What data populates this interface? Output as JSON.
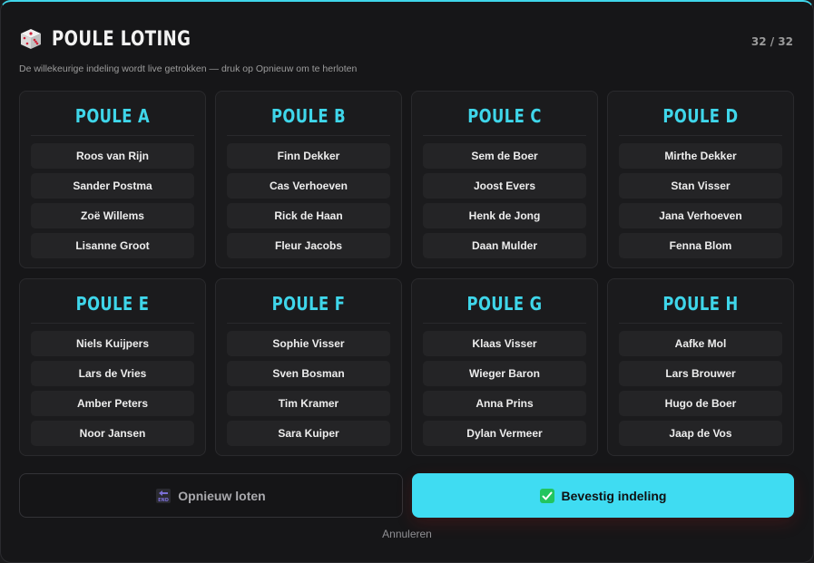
{
  "header": {
    "title": "POULE LOTING",
    "counter": "32 / 32",
    "subtitle": "De willekeurige indeling wordt live getrokken — druk op Opnieuw om te herloten",
    "icon": "dice-icon"
  },
  "poules": [
    {
      "title": "POULE A",
      "players": [
        "Roos van Rijn",
        "Sander Postma",
        "Zoë Willems",
        "Lisanne Groot"
      ]
    },
    {
      "title": "POULE B",
      "players": [
        "Finn Dekker",
        "Cas Verhoeven",
        "Rick de Haan",
        "Fleur Jacobs"
      ]
    },
    {
      "title": "POULE C",
      "players": [
        "Sem de Boer",
        "Joost Evers",
        "Henk de Jong",
        "Daan Mulder"
      ]
    },
    {
      "title": "POULE D",
      "players": [
        "Mirthe Dekker",
        "Stan Visser",
        "Jana Verhoeven",
        "Fenna Blom"
      ]
    },
    {
      "title": "POULE E",
      "players": [
        "Niels Kuijpers",
        "Lars de Vries",
        "Amber Peters",
        "Noor Jansen"
      ]
    },
    {
      "title": "POULE F",
      "players": [
        "Sophie Visser",
        "Sven Bosman",
        "Tim Kramer",
        "Sara Kuiper"
      ]
    },
    {
      "title": "POULE G",
      "players": [
        "Klaas Visser",
        "Wieger Baron",
        "Anna Prins",
        "Dylan Vermeer"
      ]
    },
    {
      "title": "POULE H",
      "players": [
        "Aafke Mol",
        "Lars Brouwer",
        "Hugo de Boer",
        "Jaap de Vos"
      ]
    }
  ],
  "actions": {
    "reroll_label": "Opnieuw loten",
    "reroll_icon": "end-arrow-icon",
    "confirm_label": "Bevestig indeling",
    "confirm_icon": "check-box-icon",
    "cancel_label": "Annuleren"
  },
  "colors": {
    "accent": "#3fd6ea",
    "confirm_bg": "#3fdcf2",
    "check_green": "#22c55e"
  }
}
